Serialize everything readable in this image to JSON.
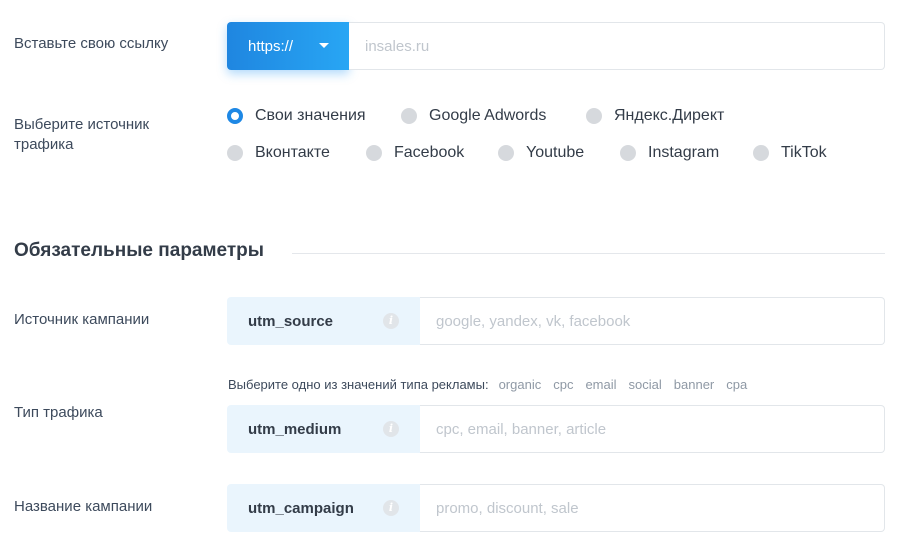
{
  "url_row": {
    "label": "Вставьте свою ссылку",
    "protocol": "https://",
    "placeholder": "insales.ru"
  },
  "traffic_source": {
    "label_line1": "Выберите источник",
    "label_line2": "трафика",
    "options": [
      {
        "label": "Свои значения",
        "checked": true
      },
      {
        "label": "Google Adwords",
        "checked": false
      },
      {
        "label": "Яндекс.Директ",
        "checked": false
      },
      {
        "label": "Вконтакте",
        "checked": false
      },
      {
        "label": "Facebook",
        "checked": false
      },
      {
        "label": "Youtube",
        "checked": false
      },
      {
        "label": "Instagram",
        "checked": false
      },
      {
        "label": "TikTok",
        "checked": false
      }
    ]
  },
  "required_section": {
    "title": "Обязательные параметры"
  },
  "params": {
    "source": {
      "label": "Источник кампании",
      "tag": "utm_source",
      "placeholder": "google, yandex, vk, facebook"
    },
    "medium": {
      "label": "Тип трафика",
      "tag": "utm_medium",
      "placeholder": "cpc, email, banner, article"
    },
    "campaign": {
      "label": "Название кампании",
      "tag": "utm_campaign",
      "placeholder": "promo, discount, sale"
    }
  },
  "medium_hint": {
    "label": "Выберите одно из значений типа рекламы:",
    "options": [
      "organic",
      "cpc",
      "email",
      "social",
      "banner",
      "cpa"
    ]
  },
  "colors": {
    "accent": "#1e88e5",
    "tag_bg": "#eaf5fd"
  }
}
